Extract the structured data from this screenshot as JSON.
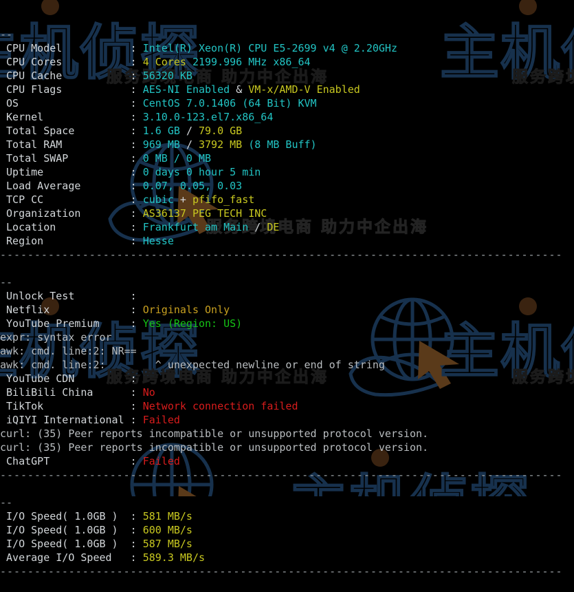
{
  "terminal": {
    "type": "bench-script-output",
    "top_marker": "--",
    "sections": [
      {
        "name": "system-info",
        "rows": [
          {
            "label": "CPU Model",
            "sep": ":",
            "parts": [
              {
                "t": "Intel(R) Xeon(R) CPU E5-2699 v4 @ 2.20GHz",
                "c": "cyan"
              }
            ]
          },
          {
            "label": "CPU Cores",
            "sep": ":",
            "parts": [
              {
                "t": "4 Cores ",
                "c": "yellow"
              },
              {
                "t": "2199.996 MHz ",
                "c": "cyan"
              },
              {
                "t": "x86_64",
                "c": "cyan"
              }
            ]
          },
          {
            "label": "CPU Cache",
            "sep": ":",
            "parts": [
              {
                "t": "56320 KB",
                "c": "cyan"
              }
            ]
          },
          {
            "label": "CPU Flags",
            "sep": ":",
            "parts": [
              {
                "t": "AES-NI Enabled ",
                "c": "cyan"
              },
              {
                "t": "& ",
                "c": "white"
              },
              {
                "t": "VM-x/AMD-V Enabled",
                "c": "yellow"
              }
            ]
          },
          {
            "label": "OS",
            "sep": ":",
            "parts": [
              {
                "t": "CentOS 7.0.1406 (64 Bit) KVM",
                "c": "cyan"
              }
            ]
          },
          {
            "label": "Kernel",
            "sep": ":",
            "parts": [
              {
                "t": "3.10.0-123.el7.x86_64",
                "c": "cyan"
              }
            ]
          },
          {
            "label": "Total Space",
            "sep": ":",
            "parts": [
              {
                "t": "1.6 GB ",
                "c": "cyan"
              },
              {
                "t": "/ ",
                "c": "white"
              },
              {
                "t": "79.0 GB",
                "c": "yellow"
              }
            ]
          },
          {
            "label": "Total RAM",
            "sep": ":",
            "parts": [
              {
                "t": "969 MB ",
                "c": "cyan"
              },
              {
                "t": "/ ",
                "c": "white"
              },
              {
                "t": "3792 MB ",
                "c": "yellow"
              },
              {
                "t": "(8 MB Buff)",
                "c": "cyan"
              }
            ]
          },
          {
            "label": "Total SWAP",
            "sep": ":",
            "parts": [
              {
                "t": "0 MB / 0 MB",
                "c": "cyan"
              }
            ]
          },
          {
            "label": "Uptime",
            "sep": ":",
            "parts": [
              {
                "t": "0 days 0 hour 5 min",
                "c": "cyan"
              }
            ]
          },
          {
            "label": "Load Average",
            "sep": ":",
            "parts": [
              {
                "t": "0.07, 0.05, 0.03",
                "c": "cyan"
              }
            ]
          },
          {
            "label": "TCP CC",
            "sep": ":",
            "parts": [
              {
                "t": "cubic ",
                "c": "cyan"
              },
              {
                "t": "+ ",
                "c": "white"
              },
              {
                "t": "pfifo_fast",
                "c": "yellow"
              }
            ]
          },
          {
            "label": "Organization",
            "sep": ":",
            "parts": [
              {
                "t": "AS36137 PEG TECH INC",
                "c": "yellow"
              }
            ]
          },
          {
            "label": "Location",
            "sep": ":",
            "parts": [
              {
                "t": "Frankfurt am Main ",
                "c": "cyan"
              },
              {
                "t": "/ ",
                "c": "white"
              },
              {
                "t": "DE",
                "c": "yellow"
              }
            ]
          },
          {
            "label": "Region",
            "sep": ":",
            "parts": [
              {
                "t": "Hesse",
                "c": "cyan"
              }
            ]
          }
        ]
      },
      {
        "name": "unlock-test",
        "marker": "--",
        "rows": [
          {
            "label": "Unlock Test",
            "sep": ":",
            "parts": []
          },
          {
            "label": "Netflix",
            "sep": ":",
            "parts": [
              {
                "t": "Originals Only",
                "c": "orange"
              }
            ]
          },
          {
            "label": "YouTube Premium",
            "sep": ":",
            "parts": [
              {
                "t": "Yes (Region: US)",
                "c": "green"
              }
            ]
          }
        ],
        "errors_after_youtube": [
          "expr: syntax error",
          "awk: cmd. line:2: NR==",
          "awk: cmd. line:2:        ^ unexpected newline or end of string"
        ],
        "rows2": [
          {
            "label": "YouTube CDN",
            "sep": ":",
            "parts": []
          },
          {
            "label": "BiliBili China",
            "sep": ":",
            "parts": [
              {
                "t": "No",
                "c": "red"
              }
            ]
          },
          {
            "label": "TikTok",
            "sep": ":",
            "parts": [
              {
                "t": "Network connection failed",
                "c": "red"
              }
            ]
          },
          {
            "label": "iQIYI International",
            "sep": ":",
            "parts": [
              {
                "t": "Failed",
                "c": "red"
              }
            ]
          }
        ],
        "errors_after_iqiyi": [
          "curl: (35) Peer reports incompatible or unsupported protocol version.",
          "curl: (35) Peer reports incompatible or unsupported protocol version."
        ],
        "rows3": [
          {
            "label": "ChatGPT",
            "sep": ":",
            "parts": [
              {
                "t": "Failed",
                "c": "red"
              }
            ]
          }
        ]
      },
      {
        "name": "io-speed",
        "marker": "--",
        "rows": [
          {
            "label": "I/O Speed( 1.0GB )",
            "sep": ":",
            "parts": [
              {
                "t": "581 MB/s",
                "c": "yellow"
              }
            ]
          },
          {
            "label": "I/O Speed( 1.0GB )",
            "sep": ":",
            "parts": [
              {
                "t": "600 MB/s",
                "c": "yellow"
              }
            ]
          },
          {
            "label": "I/O Speed( 1.0GB )",
            "sep": ":",
            "parts": [
              {
                "t": "587 MB/s",
                "c": "yellow"
              }
            ]
          },
          {
            "label": "Average I/O Speed",
            "sep": ":",
            "parts": [
              {
                "t": "589.3 MB/s",
                "c": "yellow"
              }
            ]
          }
        ]
      }
    ],
    "divider": "----------------------------------------------------------------------------------"
  },
  "watermark": {
    "logo_text": "主机侦探",
    "tagline": "服务跨境电商 助力中企出海",
    "color": "#17314d"
  },
  "colors": {
    "background": "#000000",
    "label": "#d3d7da",
    "cyan": "#22c4c4",
    "yellow": "#c8c820",
    "green": "#15c315",
    "orange": "#c8a020",
    "red": "#d81c1c",
    "rule": "#9aa0a4"
  }
}
